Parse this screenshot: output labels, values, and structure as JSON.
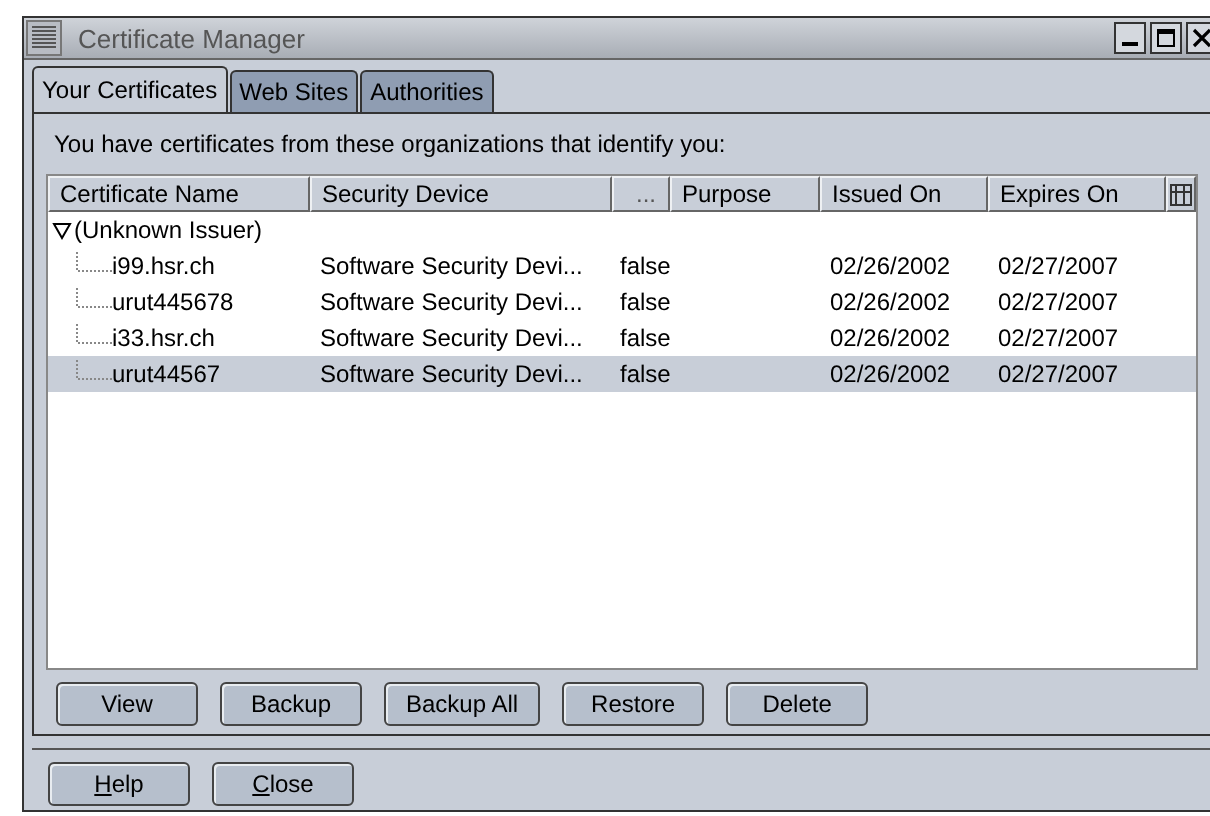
{
  "window": {
    "title": "Certificate Manager"
  },
  "tabs": [
    {
      "label": "Your Certificates",
      "selected": true
    },
    {
      "label": "Web Sites",
      "selected": false
    },
    {
      "label": "Authorities",
      "selected": false
    }
  ],
  "intro": "You have certificates from these organizations that identify you:",
  "table": {
    "columns": [
      "Certificate Name",
      "Security Device",
      "...",
      "Purpose",
      "Issued On",
      "Expires On"
    ],
    "tree": [
      {
        "label": "(Unknown Issuer)",
        "expanded": true,
        "children": [
          {
            "cells": [
              "i99.hsr.ch",
              "Software Security Devi...",
              "false",
              "",
              "02/26/2002",
              "02/27/2007"
            ],
            "selected": false
          },
          {
            "cells": [
              "urut445678",
              "Software Security Devi...",
              "false",
              "",
              "02/26/2002",
              "02/27/2007"
            ],
            "selected": false
          },
          {
            "cells": [
              "i33.hsr.ch",
              "Software Security Devi...",
              "false",
              "",
              "02/26/2002",
              "02/27/2007"
            ],
            "selected": false
          },
          {
            "cells": [
              "urut44567",
              "Software Security Devi...",
              "false",
              "",
              "02/26/2002",
              "02/27/2007"
            ],
            "selected": true
          }
        ]
      }
    ]
  },
  "actions": [
    "View",
    "Backup",
    "Backup All",
    "Restore",
    "Delete"
  ],
  "dialog_buttons": [
    {
      "mnemonic": "H",
      "rest": "elp"
    },
    {
      "mnemonic": "C",
      "rest": "lose"
    }
  ]
}
